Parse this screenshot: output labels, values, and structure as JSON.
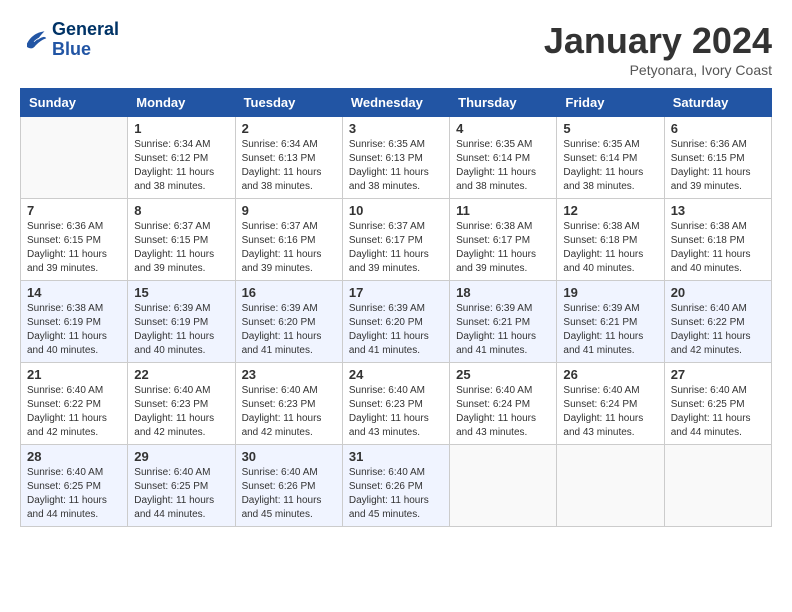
{
  "logo": {
    "line1": "General",
    "line2": "Blue"
  },
  "title": "January 2024",
  "location": "Petyonara, Ivory Coast",
  "days_of_week": [
    "Sunday",
    "Monday",
    "Tuesday",
    "Wednesday",
    "Thursday",
    "Friday",
    "Saturday"
  ],
  "weeks": [
    [
      {
        "day": "",
        "sunrise": "",
        "sunset": "",
        "daylight": ""
      },
      {
        "day": "1",
        "sunrise": "Sunrise: 6:34 AM",
        "sunset": "Sunset: 6:12 PM",
        "daylight": "Daylight: 11 hours and 38 minutes."
      },
      {
        "day": "2",
        "sunrise": "Sunrise: 6:34 AM",
        "sunset": "Sunset: 6:13 PM",
        "daylight": "Daylight: 11 hours and 38 minutes."
      },
      {
        "day": "3",
        "sunrise": "Sunrise: 6:35 AM",
        "sunset": "Sunset: 6:13 PM",
        "daylight": "Daylight: 11 hours and 38 minutes."
      },
      {
        "day": "4",
        "sunrise": "Sunrise: 6:35 AM",
        "sunset": "Sunset: 6:14 PM",
        "daylight": "Daylight: 11 hours and 38 minutes."
      },
      {
        "day": "5",
        "sunrise": "Sunrise: 6:35 AM",
        "sunset": "Sunset: 6:14 PM",
        "daylight": "Daylight: 11 hours and 38 minutes."
      },
      {
        "day": "6",
        "sunrise": "Sunrise: 6:36 AM",
        "sunset": "Sunset: 6:15 PM",
        "daylight": "Daylight: 11 hours and 39 minutes."
      }
    ],
    [
      {
        "day": "7",
        "sunrise": "Sunrise: 6:36 AM",
        "sunset": "Sunset: 6:15 PM",
        "daylight": "Daylight: 11 hours and 39 minutes."
      },
      {
        "day": "8",
        "sunrise": "Sunrise: 6:37 AM",
        "sunset": "Sunset: 6:15 PM",
        "daylight": "Daylight: 11 hours and 39 minutes."
      },
      {
        "day": "9",
        "sunrise": "Sunrise: 6:37 AM",
        "sunset": "Sunset: 6:16 PM",
        "daylight": "Daylight: 11 hours and 39 minutes."
      },
      {
        "day": "10",
        "sunrise": "Sunrise: 6:37 AM",
        "sunset": "Sunset: 6:17 PM",
        "daylight": "Daylight: 11 hours and 39 minutes."
      },
      {
        "day": "11",
        "sunrise": "Sunrise: 6:38 AM",
        "sunset": "Sunset: 6:17 PM",
        "daylight": "Daylight: 11 hours and 39 minutes."
      },
      {
        "day": "12",
        "sunrise": "Sunrise: 6:38 AM",
        "sunset": "Sunset: 6:18 PM",
        "daylight": "Daylight: 11 hours and 40 minutes."
      },
      {
        "day": "13",
        "sunrise": "Sunrise: 6:38 AM",
        "sunset": "Sunset: 6:18 PM",
        "daylight": "Daylight: 11 hours and 40 minutes."
      }
    ],
    [
      {
        "day": "14",
        "sunrise": "Sunrise: 6:38 AM",
        "sunset": "Sunset: 6:19 PM",
        "daylight": "Daylight: 11 hours and 40 minutes."
      },
      {
        "day": "15",
        "sunrise": "Sunrise: 6:39 AM",
        "sunset": "Sunset: 6:19 PM",
        "daylight": "Daylight: 11 hours and 40 minutes."
      },
      {
        "day": "16",
        "sunrise": "Sunrise: 6:39 AM",
        "sunset": "Sunset: 6:20 PM",
        "daylight": "Daylight: 11 hours and 41 minutes."
      },
      {
        "day": "17",
        "sunrise": "Sunrise: 6:39 AM",
        "sunset": "Sunset: 6:20 PM",
        "daylight": "Daylight: 11 hours and 41 minutes."
      },
      {
        "day": "18",
        "sunrise": "Sunrise: 6:39 AM",
        "sunset": "Sunset: 6:21 PM",
        "daylight": "Daylight: 11 hours and 41 minutes."
      },
      {
        "day": "19",
        "sunrise": "Sunrise: 6:39 AM",
        "sunset": "Sunset: 6:21 PM",
        "daylight": "Daylight: 11 hours and 41 minutes."
      },
      {
        "day": "20",
        "sunrise": "Sunrise: 6:40 AM",
        "sunset": "Sunset: 6:22 PM",
        "daylight": "Daylight: 11 hours and 42 minutes."
      }
    ],
    [
      {
        "day": "21",
        "sunrise": "Sunrise: 6:40 AM",
        "sunset": "Sunset: 6:22 PM",
        "daylight": "Daylight: 11 hours and 42 minutes."
      },
      {
        "day": "22",
        "sunrise": "Sunrise: 6:40 AM",
        "sunset": "Sunset: 6:23 PM",
        "daylight": "Daylight: 11 hours and 42 minutes."
      },
      {
        "day": "23",
        "sunrise": "Sunrise: 6:40 AM",
        "sunset": "Sunset: 6:23 PM",
        "daylight": "Daylight: 11 hours and 42 minutes."
      },
      {
        "day": "24",
        "sunrise": "Sunrise: 6:40 AM",
        "sunset": "Sunset: 6:23 PM",
        "daylight": "Daylight: 11 hours and 43 minutes."
      },
      {
        "day": "25",
        "sunrise": "Sunrise: 6:40 AM",
        "sunset": "Sunset: 6:24 PM",
        "daylight": "Daylight: 11 hours and 43 minutes."
      },
      {
        "day": "26",
        "sunrise": "Sunrise: 6:40 AM",
        "sunset": "Sunset: 6:24 PM",
        "daylight": "Daylight: 11 hours and 43 minutes."
      },
      {
        "day": "27",
        "sunrise": "Sunrise: 6:40 AM",
        "sunset": "Sunset: 6:25 PM",
        "daylight": "Daylight: 11 hours and 44 minutes."
      }
    ],
    [
      {
        "day": "28",
        "sunrise": "Sunrise: 6:40 AM",
        "sunset": "Sunset: 6:25 PM",
        "daylight": "Daylight: 11 hours and 44 minutes."
      },
      {
        "day": "29",
        "sunrise": "Sunrise: 6:40 AM",
        "sunset": "Sunset: 6:25 PM",
        "daylight": "Daylight: 11 hours and 44 minutes."
      },
      {
        "day": "30",
        "sunrise": "Sunrise: 6:40 AM",
        "sunset": "Sunset: 6:26 PM",
        "daylight": "Daylight: 11 hours and 45 minutes."
      },
      {
        "day": "31",
        "sunrise": "Sunrise: 6:40 AM",
        "sunset": "Sunset: 6:26 PM",
        "daylight": "Daylight: 11 hours and 45 minutes."
      },
      {
        "day": "",
        "sunrise": "",
        "sunset": "",
        "daylight": ""
      },
      {
        "day": "",
        "sunrise": "",
        "sunset": "",
        "daylight": ""
      },
      {
        "day": "",
        "sunrise": "",
        "sunset": "",
        "daylight": ""
      }
    ]
  ]
}
